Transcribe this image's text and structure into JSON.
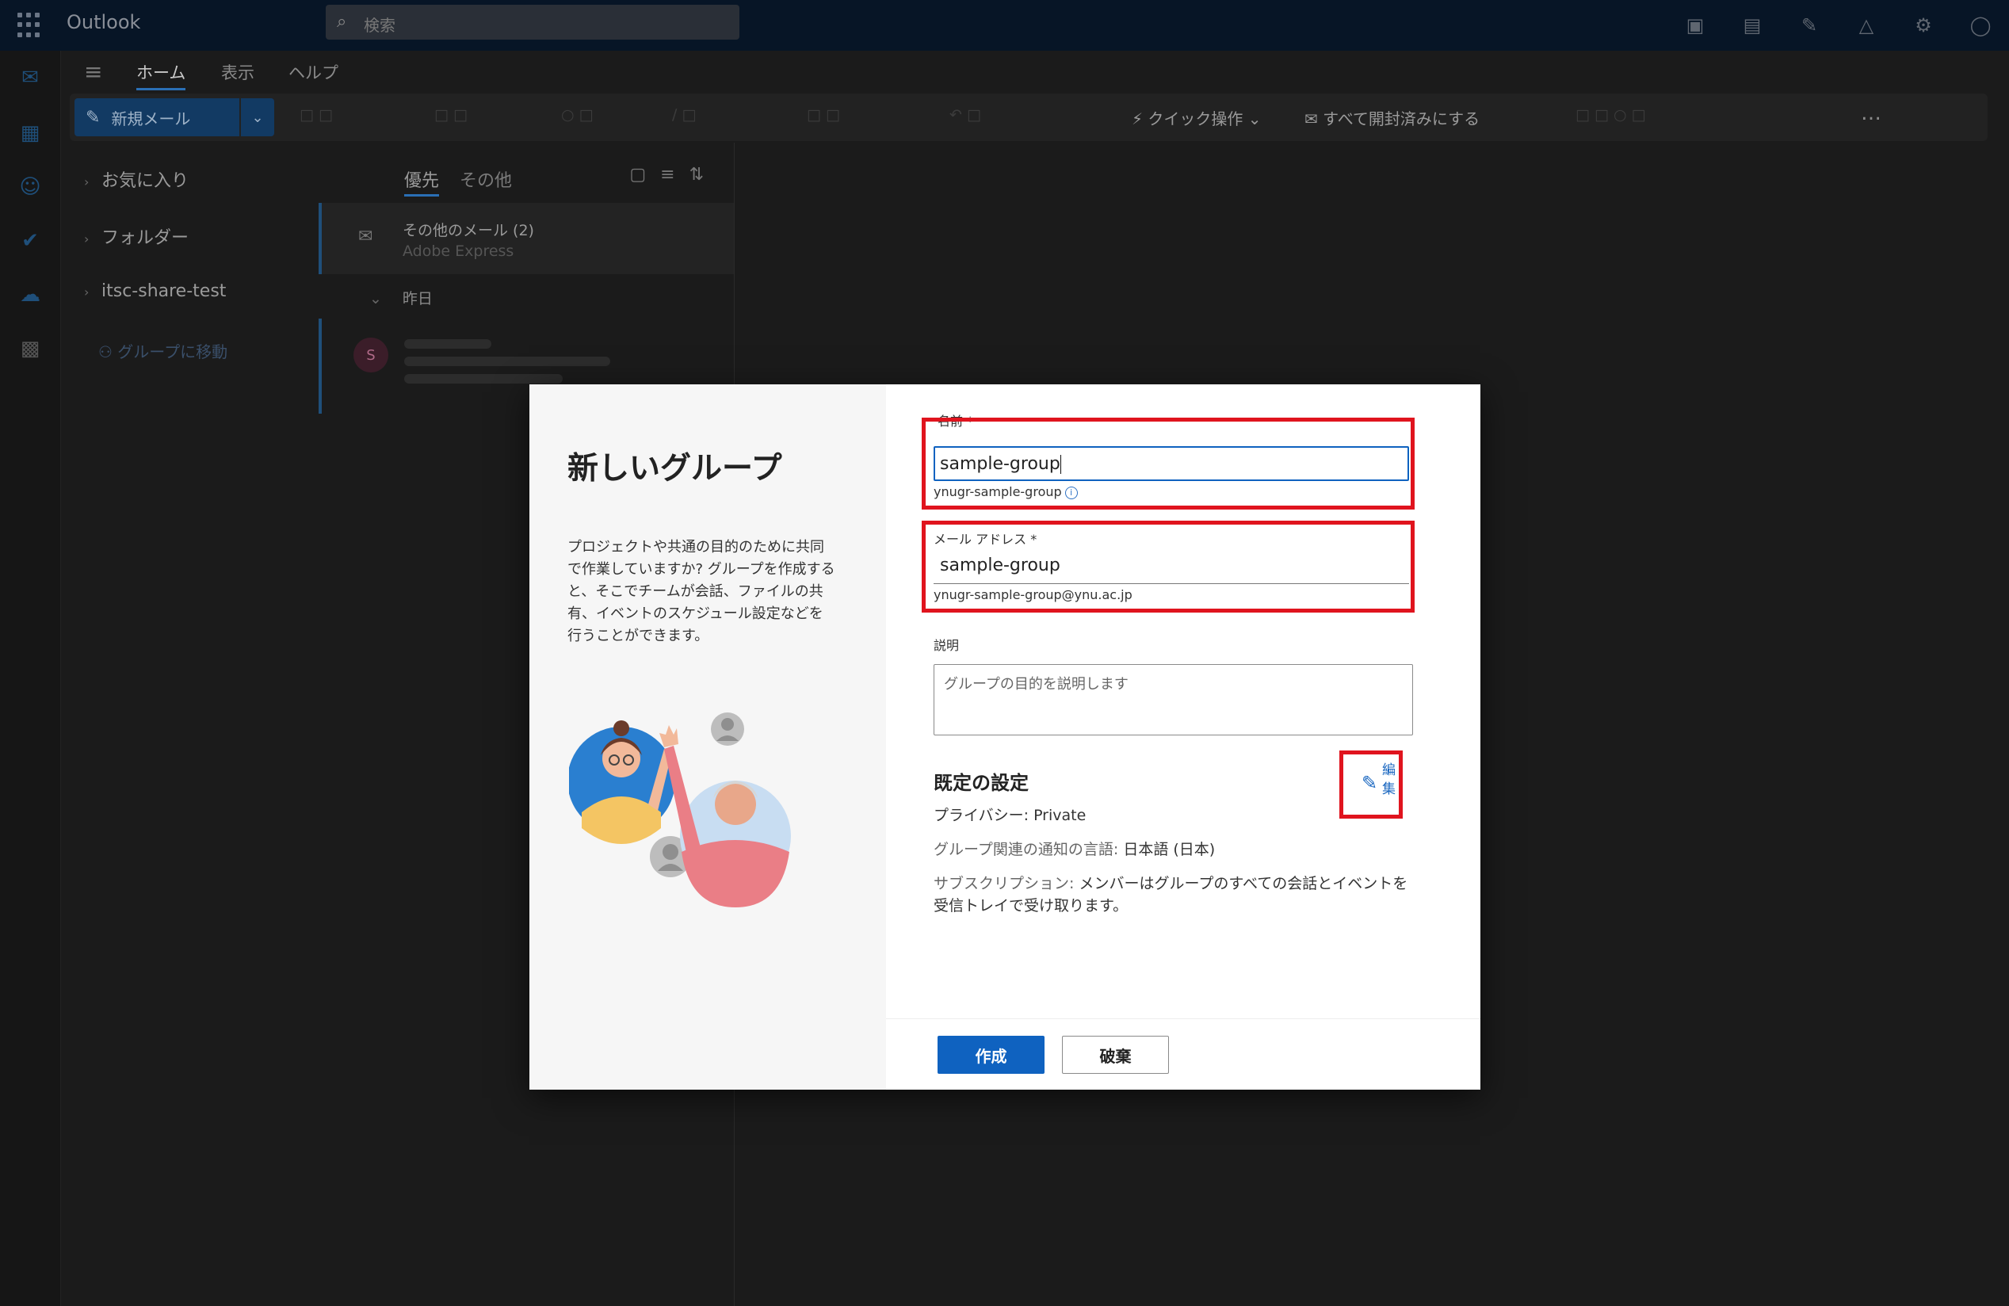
{
  "app": {
    "name": "Outlook"
  },
  "search": {
    "placeholder": "検索"
  },
  "ribbon": {
    "tabs": [
      "ホーム",
      "表示",
      "ヘルプ"
    ],
    "new_mail": "新規メール",
    "quick_actions": "クイック操作",
    "mark_all_read": "すべて開封済みにする",
    "more": "…"
  },
  "folders": {
    "items": [
      "お気に入り",
      "フォルダー",
      "itsc-share-test"
    ],
    "go_to_groups": "グループに移動"
  },
  "maillist": {
    "tab_focused": "優先",
    "tab_other": "その他",
    "row_from": "その他のメール (2)",
    "row_sub": "Adobe Express",
    "date_group": "昨日",
    "avatar_letter": "S"
  },
  "dialog": {
    "title": "新しいグループ",
    "description": "プロジェクトや共通の目的のために共同で作業していますか? グループを作成すると、そこでチームが会話、ファイルの共有、イベントのスケジュール設定などを行うことができます。",
    "name_label": "名前",
    "name_value": "sample-group",
    "name_hint": "ynugr-sample-group",
    "email_label": "メール アドレス",
    "email_value": "sample-group",
    "email_hint": "ynugr-sample-group@ynu.ac.jp",
    "required_mark": "*",
    "desc_label": "説明",
    "desc_placeholder": "グループの目的を説明します",
    "defaults_title": "既定の設定",
    "edit_label": "編集",
    "privacy_key": "プライバシー: ",
    "privacy_value": "Private",
    "lang_key": "グループ関連の通知の言語: ",
    "lang_value": "日本語 (日本)",
    "sub_key": "サブスクリプション: ",
    "sub_value": "メンバーはグループのすべての会話とイベントを受信トレイで受け取ります。",
    "create": "作成",
    "discard": "破棄"
  },
  "colors": {
    "accent": "#0f62c0",
    "highlight": "#e0141e"
  }
}
